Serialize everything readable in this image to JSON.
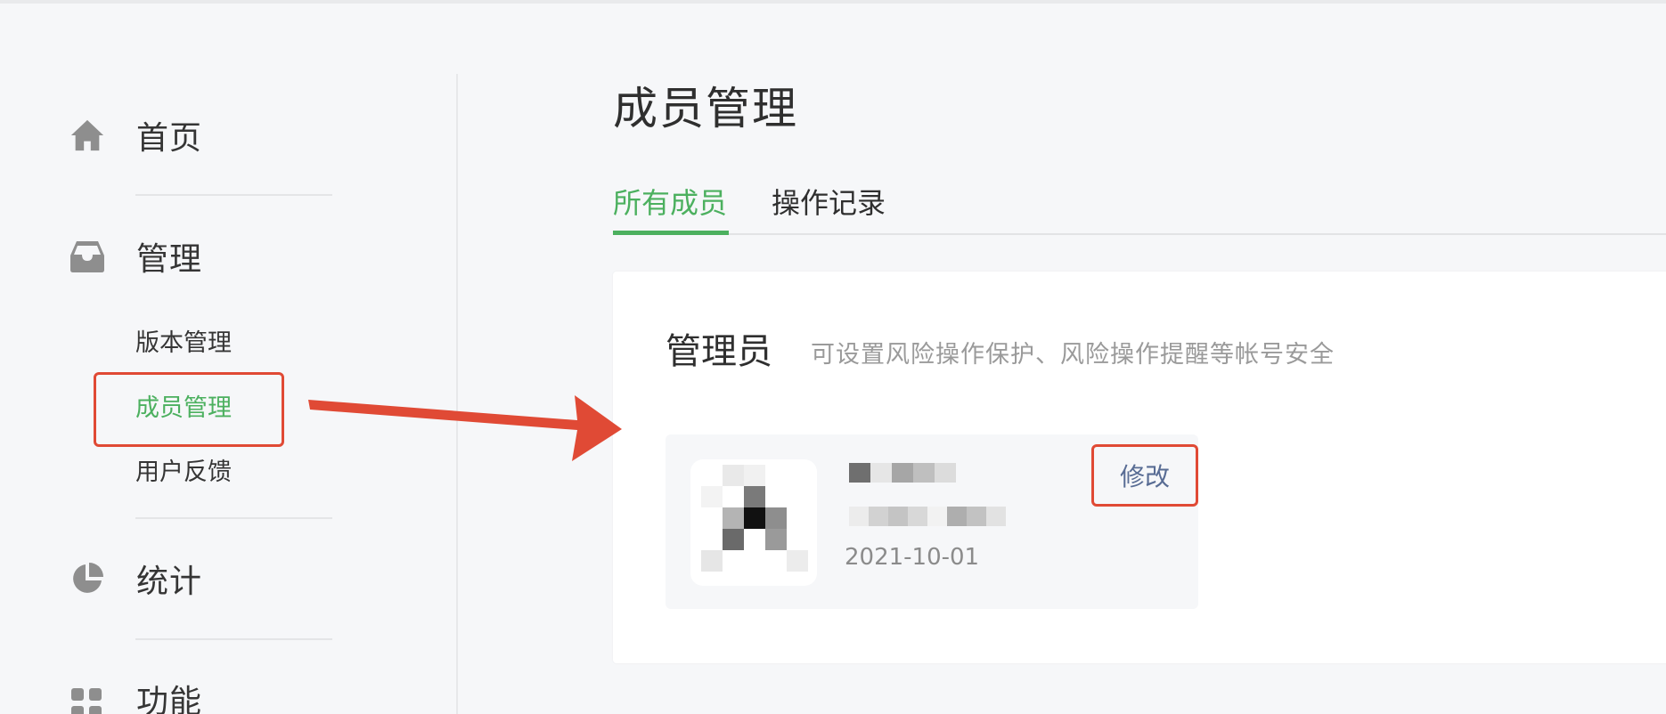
{
  "sidebar": {
    "items": [
      {
        "label": "首页",
        "icon": "home-icon"
      },
      {
        "label": "管理",
        "icon": "inbox-icon"
      },
      {
        "label": "统计",
        "icon": "pie-chart-icon"
      },
      {
        "label": "功能",
        "icon": "grid-icon"
      }
    ],
    "sub_items": [
      {
        "label": "版本管理"
      },
      {
        "label": "成员管理",
        "active": true
      },
      {
        "label": "用户反馈"
      }
    ]
  },
  "main": {
    "title": "成员管理",
    "tabs": [
      {
        "label": "所有成员",
        "active": true
      },
      {
        "label": "操作记录"
      }
    ],
    "section": {
      "title": "管理员",
      "description": "可设置风险操作保护、风险操作提醒等帐号安全"
    },
    "member": {
      "date": "2021-10-01",
      "edit_label": "修改"
    }
  },
  "colors": {
    "accent": "#4cb05f",
    "annotation": "#e04a35",
    "edit_text": "#586c94"
  }
}
